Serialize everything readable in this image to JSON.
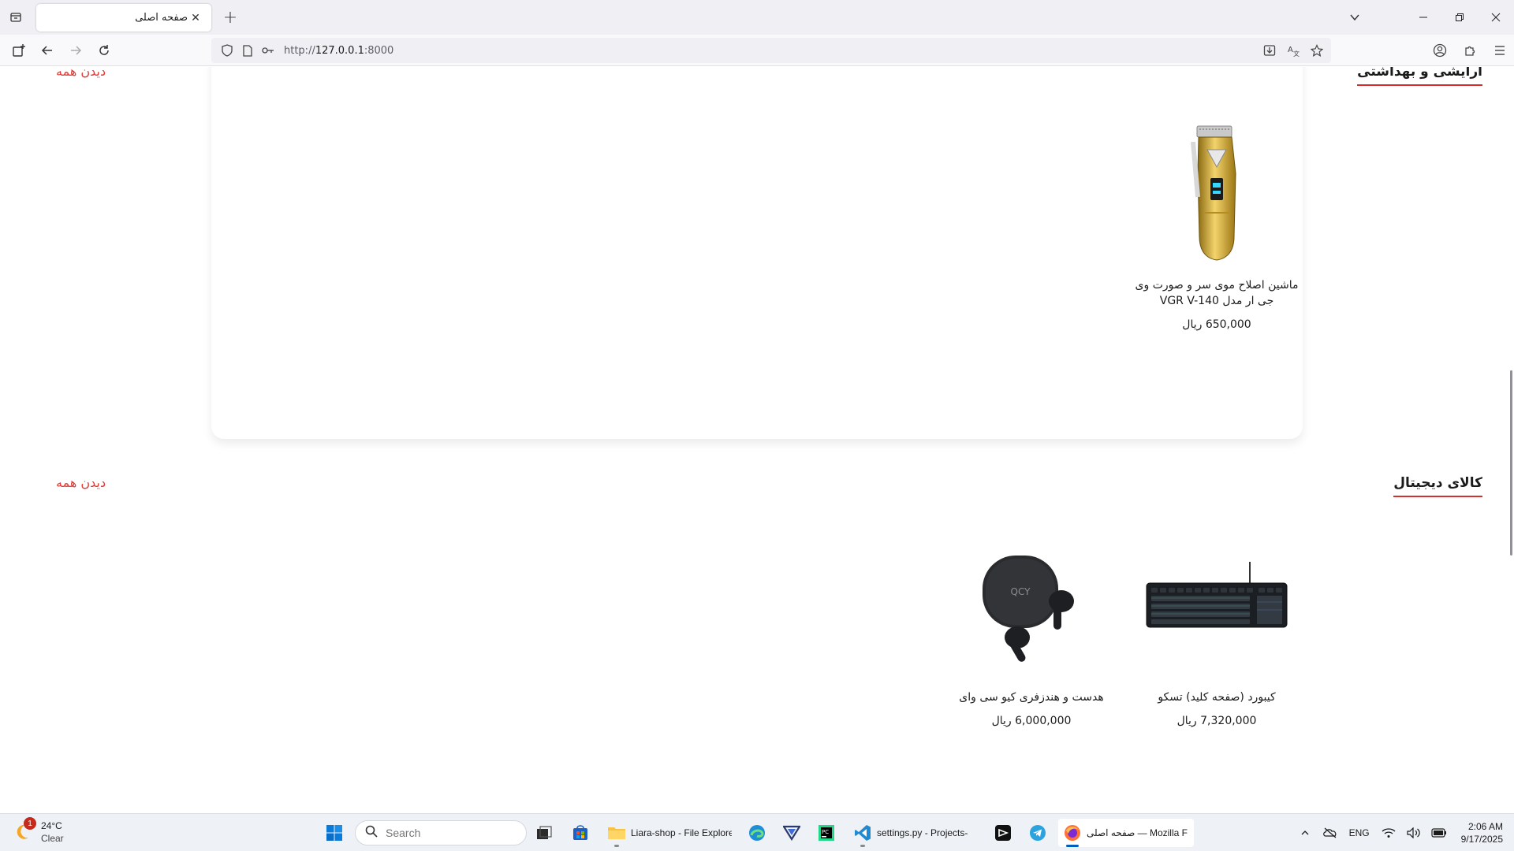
{
  "browser": {
    "tab_title": "صفحه اصلی",
    "tab_close": "✕",
    "new_tab": "+",
    "url_prefix": "http://",
    "url_host": "127.0.0.1",
    "url_port": ":8000"
  },
  "sections": [
    {
      "title": "آرایشی و بهداشتی",
      "see_all": "دیدن همه",
      "products": [
        {
          "name": "ماشین اصلاح موی سر و صورت وی جی ار مدل VGR V-140",
          "price": "650,000 ریال",
          "image": "hair-clipper"
        }
      ]
    },
    {
      "title": "کالای دیجیتال",
      "see_all": "دیدن همه",
      "products": [
        {
          "name": "کیبورد (صفحه کلید) تسکو",
          "price": "7,320,000 ریال",
          "image": "keyboard"
        },
        {
          "name": "هدست و هندزفری کیو سی وای",
          "price": "6,000,000 ریال",
          "image": "earbuds"
        }
      ]
    }
  ],
  "colors": {
    "accent": "#e53935",
    "underline": "#d32f2f"
  },
  "taskbar": {
    "weather_temp": "24°C",
    "weather_cond": "Clear",
    "weather_badge": "1",
    "search_placeholder": "Search",
    "explorer_label": "Liara-shop - File Explore",
    "vscode_label": "settings.py - Projects-sh",
    "firefox_label": "صفحه اصلی — Mozilla F",
    "lang": "ENG",
    "time": "2:06 AM",
    "date": "9/17/2025"
  }
}
